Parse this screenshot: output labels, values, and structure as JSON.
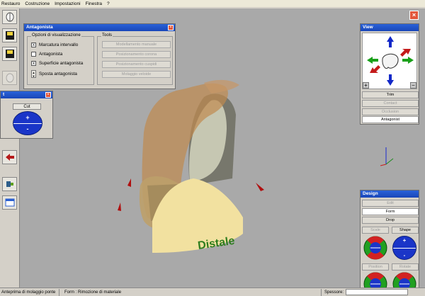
{
  "menu": [
    "Restauro",
    "Costruzione",
    "Impostazioni",
    "Finestra",
    "?"
  ],
  "antagonista": {
    "title": "Antagonista",
    "options_legend": "Opzioni di visualizzazione",
    "options": [
      {
        "label": "Marcatura intervallo",
        "checked": "x"
      },
      {
        "label": "Antagonista",
        "checked": ""
      },
      {
        "label": "Superficie antagonista",
        "checked": "x"
      }
    ],
    "move_label": "Sposta antagonista",
    "tools_legend": "Tools",
    "tools": [
      "Modellamento manuale",
      "Posizionamento corona",
      "Posizionamento cuspidi",
      "Molaggio veloide"
    ]
  },
  "cut_panel": {
    "title": "t",
    "label": "Cut",
    "plus": "+",
    "minus": "-"
  },
  "view_panel": {
    "title": "View",
    "buttons": [
      {
        "label": "Trim",
        "state": "enabled"
      },
      {
        "label": "Contact",
        "state": "disabled"
      },
      {
        "label": "Occlusion",
        "state": "disabled"
      },
      {
        "label": "Antagonist",
        "state": "white"
      }
    ],
    "zoom_in": "+",
    "zoom_out": "−"
  },
  "design_panel": {
    "title": "Design",
    "buttons": [
      {
        "label": "Edit",
        "state": "disabled"
      },
      {
        "label": "Form",
        "state": "white"
      },
      {
        "label": "Drop",
        "state": "enabled"
      }
    ],
    "labels": {
      "scale": "Scale",
      "shape": "Shape",
      "position": "Position",
      "rotate": "Rotate"
    },
    "shape_plus": "+",
    "shape_minus": "-"
  },
  "viewport": {
    "label": "Distale"
  },
  "status": {
    "left": "Anteprima di molaggio ponte",
    "mid": "Form : Rimozione di materiale",
    "right_label": "Spessore:"
  },
  "colors": {
    "title_bar": "#1946b8",
    "viewport_bg": "#a9a9a9",
    "label_green": "#2e7d1e"
  }
}
